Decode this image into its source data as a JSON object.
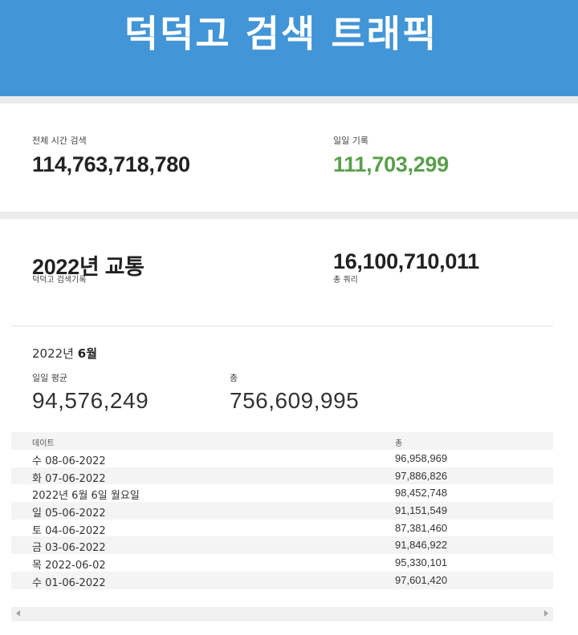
{
  "header": {
    "title": "덕덕고 검색 트래픽"
  },
  "summary": {
    "all_time_label": "전체 시간 검색",
    "all_time_value": "114,763,718,780",
    "daily_record_label": "일일 기록",
    "daily_record_value": "111,703,299"
  },
  "year": {
    "title": "2022년 교통",
    "subtitle": "덕덕고 검색기록",
    "total_value": "16,100,710,011",
    "total_label": "총 쿼리"
  },
  "month": {
    "year_text": "2022년",
    "month_text": "6월",
    "daily_avg_label": "일일 평균",
    "daily_avg_value": "94,576,249",
    "total_label": "총",
    "total_value": "756,609,995"
  },
  "table": {
    "headers": {
      "date": "데이트",
      "total": "총"
    },
    "rows": [
      {
        "date": "수 08-06-2022",
        "total": "96,958,969"
      },
      {
        "date": "화 07-06-2022",
        "total": "97,886,826"
      },
      {
        "date": "2022년 6월 6일 월요일",
        "total": "98,452,748"
      },
      {
        "date": "일 05-06-2022",
        "total": "91,151,549"
      },
      {
        "date": "토 04-06-2022",
        "total": "87,381,460"
      },
      {
        "date": "금 03-06-2022",
        "total": "91,846,922"
      },
      {
        "date": "목 2022-06-02",
        "total": "95,330,101"
      },
      {
        "date": "수 01-06-2022",
        "total": "97,601,420"
      }
    ]
  },
  "colors": {
    "header_bg": "#4295d6",
    "record_green": "#5a9f4c"
  },
  "icons": {
    "scroll_left": "scroll-left-arrow-icon",
    "scroll_right": "scroll-right-arrow-icon"
  }
}
